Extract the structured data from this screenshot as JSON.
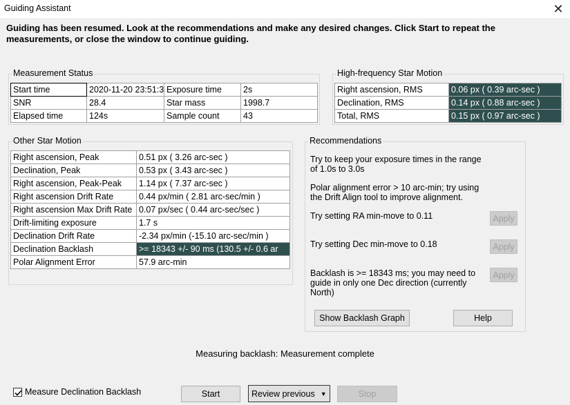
{
  "window": {
    "title": "Guiding Assistant",
    "close_icon": "close-icon"
  },
  "intro": "Guiding has been resumed. Look at the recommendations and make any desired changes.  Click Start to repeat the measurements, or close the window to continue guiding.",
  "measurement_status": {
    "title": "Measurement Status",
    "rows": [
      [
        "Start time",
        "2020-11-20 23:51:3",
        "Exposure time",
        "2s"
      ],
      [
        "SNR",
        "28.4",
        "Star mass",
        "1998.7"
      ],
      [
        "Elapsed time",
        "124s",
        "Sample count",
        "43"
      ]
    ]
  },
  "hf_motion": {
    "title": "High-frequency Star Motion",
    "rows": [
      [
        "Right ascension, RMS",
        "0.06 px ( 0.39 arc-sec )"
      ],
      [
        "Declination, RMS",
        "0.14 px ( 0.88 arc-sec )"
      ],
      [
        "Total, RMS",
        "0.15 px ( 0.97 arc-sec )"
      ]
    ]
  },
  "other_motion": {
    "title": "Other Star Motion",
    "rows": [
      [
        "Right ascension, Peak",
        "0.51 px ( 3.26 arc-sec )"
      ],
      [
        "Declination, Peak",
        "0.53 px ( 3.43 arc-sec )"
      ],
      [
        "Right ascension, Peak-Peak",
        "1.14 px ( 7.37 arc-sec )"
      ],
      [
        "Right ascension Drift Rate",
        "0.44 px/min ( 2.81 arc-sec/min )"
      ],
      [
        "Right ascension Max Drift Rate",
        "0.07 px/sec ( 0.44 arc-sec/sec )"
      ],
      [
        "Drift-limiting exposure",
        "1.7 s"
      ],
      [
        "Declination Drift Rate",
        "-2.34 px/min (-15.10 arc-sec/min )"
      ],
      [
        "Declination Backlash",
        ">= 18343  +/-  90 ms (130.5  +/-  0.6 ar"
      ],
      [
        "Polar Alignment Error",
        "57.9 arc-min"
      ]
    ]
  },
  "recommendations": {
    "title": "Recommendations",
    "exposure": "Try to keep your exposure times in the range of 1.0s to 3.0s",
    "polar": "Polar alignment error > 10 arc-min; try using the Drift Align tool to improve alignment.",
    "ra_minmove": "Try setting RA min-move to 0.11",
    "dec_minmove": "Try setting Dec min-move to 0.18",
    "backlash": "Backlash is >= 18343 ms; you may need to guide in only one Dec direction (currently North)",
    "apply_label": "Apply",
    "show_backlash_graph": "Show Backlash Graph",
    "help": "Help"
  },
  "status": "Measuring backlash: Measurement complete",
  "footer": {
    "checkbox_label": "Measure Declination Backlash",
    "checkbox_checked": true,
    "start": "Start",
    "review_previous": "Review previous",
    "stop": "Stop"
  },
  "colors": {
    "highlight": "#2f4f4f",
    "background": "#f0f0f0"
  }
}
